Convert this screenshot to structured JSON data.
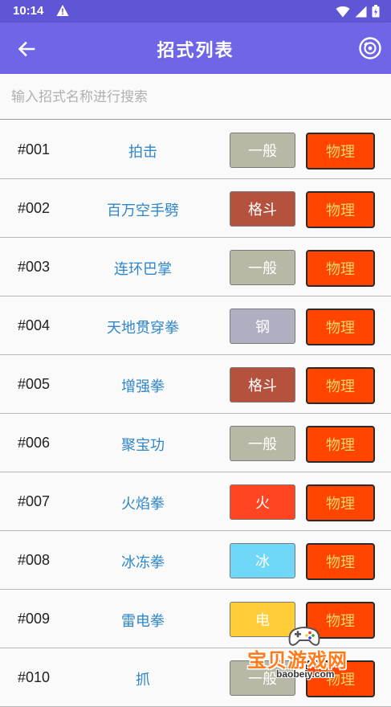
{
  "status_bar": {
    "time": "10:14",
    "warning_icon": "warning-icon",
    "icons": [
      "wifi-icon",
      "signal-icon",
      "battery-icon"
    ]
  },
  "app_bar": {
    "title": "招式列表",
    "back_icon": "back-arrow-icon",
    "action_icon": "disc-icon",
    "color": "#6e66e6"
  },
  "search": {
    "placeholder": "输入招式名称进行搜索",
    "value": ""
  },
  "moves": [
    {
      "num": "#001",
      "name": "拍击",
      "type": "一般",
      "type_color": "#b9b8a6",
      "category": "物理"
    },
    {
      "num": "#002",
      "name": "百万空手劈",
      "type": "格斗",
      "type_color": "#b5523e",
      "category": "物理"
    },
    {
      "num": "#003",
      "name": "连环巴掌",
      "type": "一般",
      "type_color": "#b9b8a6",
      "category": "物理"
    },
    {
      "num": "#004",
      "name": "天地贯穿拳",
      "type": "钢",
      "type_color": "#b0afc2",
      "category": "物理"
    },
    {
      "num": "#005",
      "name": "增强拳",
      "type": "格斗",
      "type_color": "#b5523e",
      "category": "物理"
    },
    {
      "num": "#006",
      "name": "聚宝功",
      "type": "一般",
      "type_color": "#b9b8a6",
      "category": "物理"
    },
    {
      "num": "#007",
      "name": "火焰拳",
      "type": "火",
      "type_color": "#ff4422",
      "category": "物理"
    },
    {
      "num": "#008",
      "name": "冰冻拳",
      "type": "冰",
      "type_color": "#6fd7f7",
      "category": "物理"
    },
    {
      "num": "#009",
      "name": "雷电拳",
      "type": "电",
      "type_color": "#ffcd38",
      "category": "物理"
    },
    {
      "num": "#010",
      "name": "抓",
      "type": "一般",
      "type_color": "#b9b8a6",
      "category": "物理"
    }
  ],
  "category_color": "#ff4500",
  "watermark": {
    "main": "宝贝游戏网",
    "sub": "baobeiy.com"
  }
}
